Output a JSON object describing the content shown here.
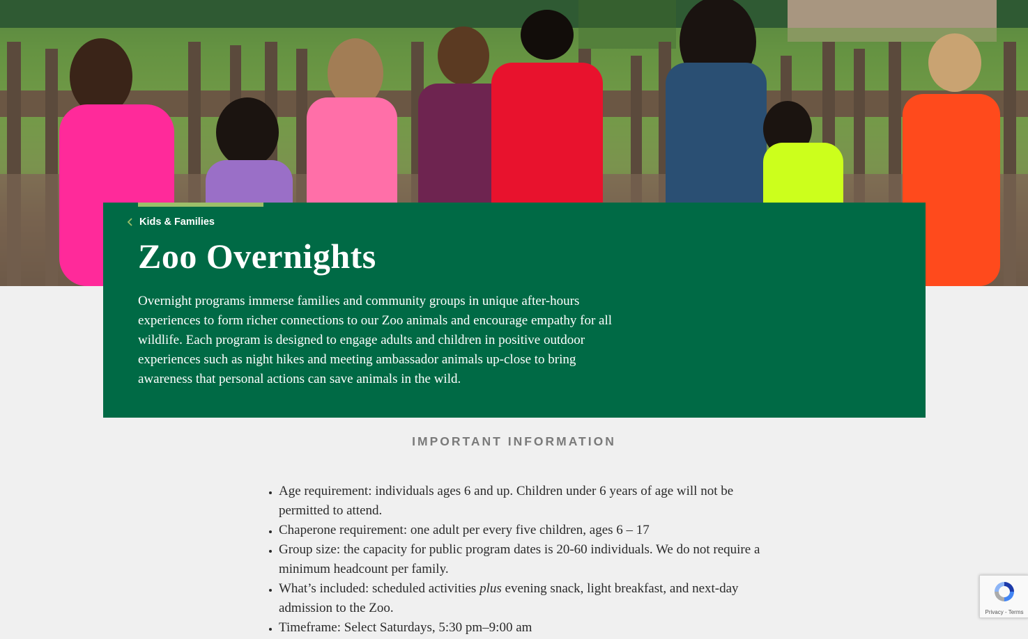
{
  "hero": {
    "image_alt": "Children looking through a wooden fence at a zoo enclosure"
  },
  "card": {
    "breadcrumb_label": "Kids & Families",
    "title": "Zoo Overnights",
    "intro": "Overnight programs immerse families and community groups in unique after-hours experiences to form richer connections to our Zoo animals and encourage empathy for all wildlife. Each program is designed to engage adults and children in positive outdoor experiences such as night hikes and meeting ambassador animals up-close to bring awareness that personal actions can save animals in the wild.",
    "accent_color": "#9cbf6a",
    "background_color": "#006a45"
  },
  "important": {
    "heading": "IMPORTANT INFORMATION",
    "items": [
      {
        "text": "Age requirement: individuals ages 6 and up. Children under 6 years of age will not be permitted to attend."
      },
      {
        "text": "Chaperone requirement: one adult per every five children, ages 6 – 17"
      },
      {
        "text": "Group size: the capacity for public program dates is 20-60 individuals. We do not require a minimum headcount per family."
      },
      {
        "before": "What’s included: scheduled activities ",
        "emph": "plus",
        "after": " evening snack, light breakfast, and next-day admission to the Zoo."
      },
      {
        "text": "Timeframe: Select Saturdays, 5:30 pm–9:00 am"
      }
    ]
  },
  "recaptcha": {
    "icon": "recaptcha-icon",
    "links": "Privacy - Terms"
  }
}
